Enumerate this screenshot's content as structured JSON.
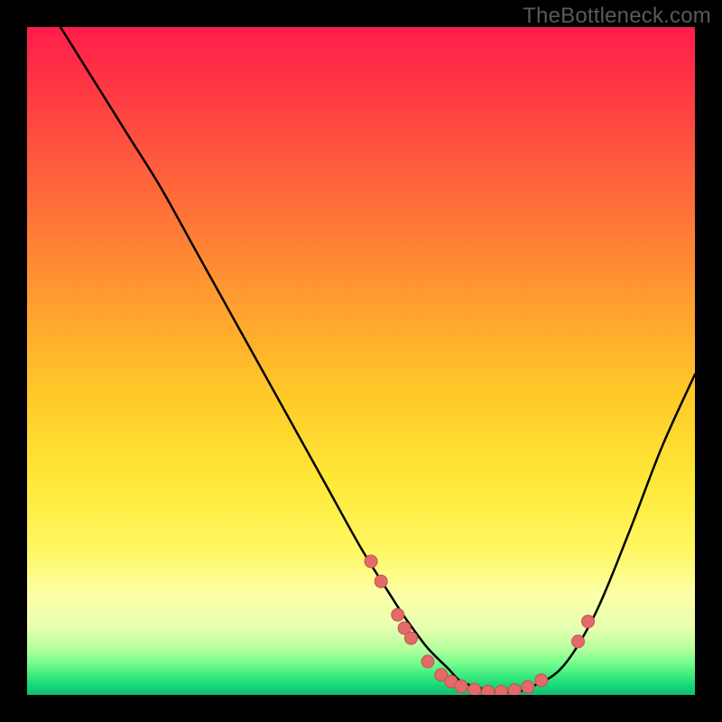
{
  "watermark": "TheBottleneck.com",
  "colors": {
    "background": "#000000",
    "gradient_top": "#ff1d4a",
    "gradient_mid": "#ffe838",
    "gradient_bottom": "#0fbf74",
    "curve": "#000000",
    "marker_fill": "#e46a6a",
    "marker_stroke": "#c64f55"
  },
  "chart_data": {
    "type": "line",
    "title": "",
    "xlabel": "",
    "ylabel": "",
    "xlim": [
      0,
      100
    ],
    "ylim": [
      0,
      100
    ],
    "series": [
      {
        "name": "bottleneck-curve",
        "x": [
          5,
          10,
          15,
          20,
          25,
          30,
          35,
          40,
          45,
          50,
          55,
          57,
          60,
          63,
          65,
          68,
          70,
          73,
          75,
          80,
          85,
          90,
          95,
          100
        ],
        "y": [
          100,
          92,
          84,
          76,
          67,
          58,
          49,
          40,
          31,
          22,
          14,
          11,
          7,
          4,
          2,
          1,
          0.5,
          0.5,
          1,
          4,
          12,
          24,
          37,
          48
        ]
      }
    ],
    "markers": [
      {
        "x": 51.5,
        "y": 20
      },
      {
        "x": 53,
        "y": 17
      },
      {
        "x": 55.5,
        "y": 12
      },
      {
        "x": 56.5,
        "y": 10
      },
      {
        "x": 57.5,
        "y": 8.5
      },
      {
        "x": 60,
        "y": 5
      },
      {
        "x": 62,
        "y": 3
      },
      {
        "x": 63.5,
        "y": 2
      },
      {
        "x": 65,
        "y": 1.3
      },
      {
        "x": 67,
        "y": 0.8
      },
      {
        "x": 69,
        "y": 0.5
      },
      {
        "x": 71,
        "y": 0.5
      },
      {
        "x": 73,
        "y": 0.7
      },
      {
        "x": 75,
        "y": 1.2
      },
      {
        "x": 77,
        "y": 2.2
      },
      {
        "x": 82.5,
        "y": 8
      },
      {
        "x": 84,
        "y": 11
      }
    ]
  }
}
